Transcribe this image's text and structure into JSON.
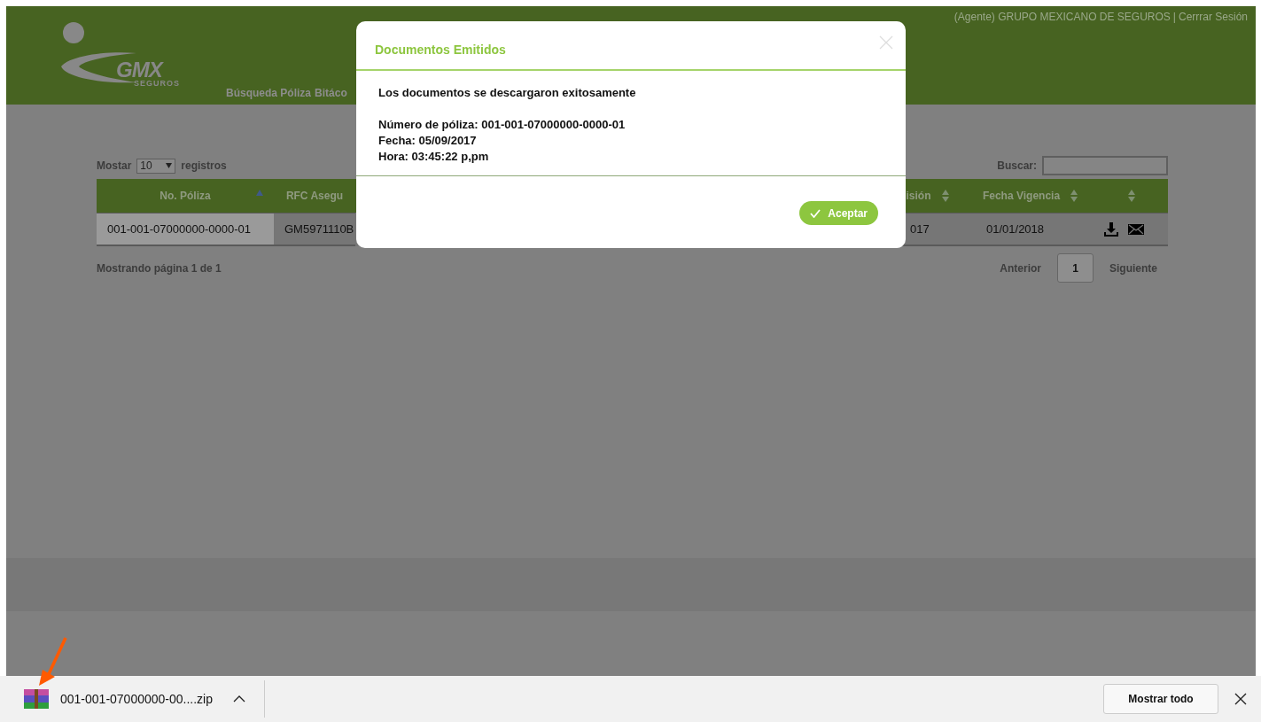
{
  "header": {
    "logo": {
      "name": "GMX",
      "tagline": "SEGUROS"
    },
    "nav": [
      "Búsqueda Póliza",
      "Bitáco"
    ],
    "user_info": "(Agente) GRUPO MEXICANO DE SEGUROS",
    "separator": "|",
    "logout": "Cerrrar Sesión"
  },
  "table_controls": {
    "show_label": "Mostar",
    "page_size": "10",
    "records_label": "registros",
    "search_label": "Buscar:"
  },
  "table": {
    "columns": [
      {
        "label": "No. Póliza",
        "kind": "ascending"
      },
      {
        "label": "RFC Asegu",
        "kind": "plain"
      },
      {
        "label": "isión",
        "kind": "sortable"
      },
      {
        "label": "Fecha Vigencia",
        "kind": "sortable"
      },
      {
        "kind": "sortable"
      }
    ],
    "rows": [
      {
        "cells": [
          "001-001-07000000-0000-01",
          "GM5971110B",
          "017",
          "01/01/2018"
        ]
      }
    ]
  },
  "info": "Mostrando página 1 de 1",
  "pagination": {
    "previous": "Anterior",
    "pages": [
      {
        "label": "1",
        "selected": true
      }
    ],
    "next": "Siguiente"
  },
  "modal": {
    "title": "Documentos Emitidos",
    "message": "Los documentos se descargaron exitosamente",
    "details": [
      "Número de póliza: 001-001-07000000-0000-01",
      "Fecha: 05/09/2017",
      "Hora: 03:45:22 p,pm"
    ],
    "button": "Aceptar"
  },
  "download_bar": {
    "file": "001-001-07000000-00....zip",
    "show_all": "Mostrar todo"
  }
}
